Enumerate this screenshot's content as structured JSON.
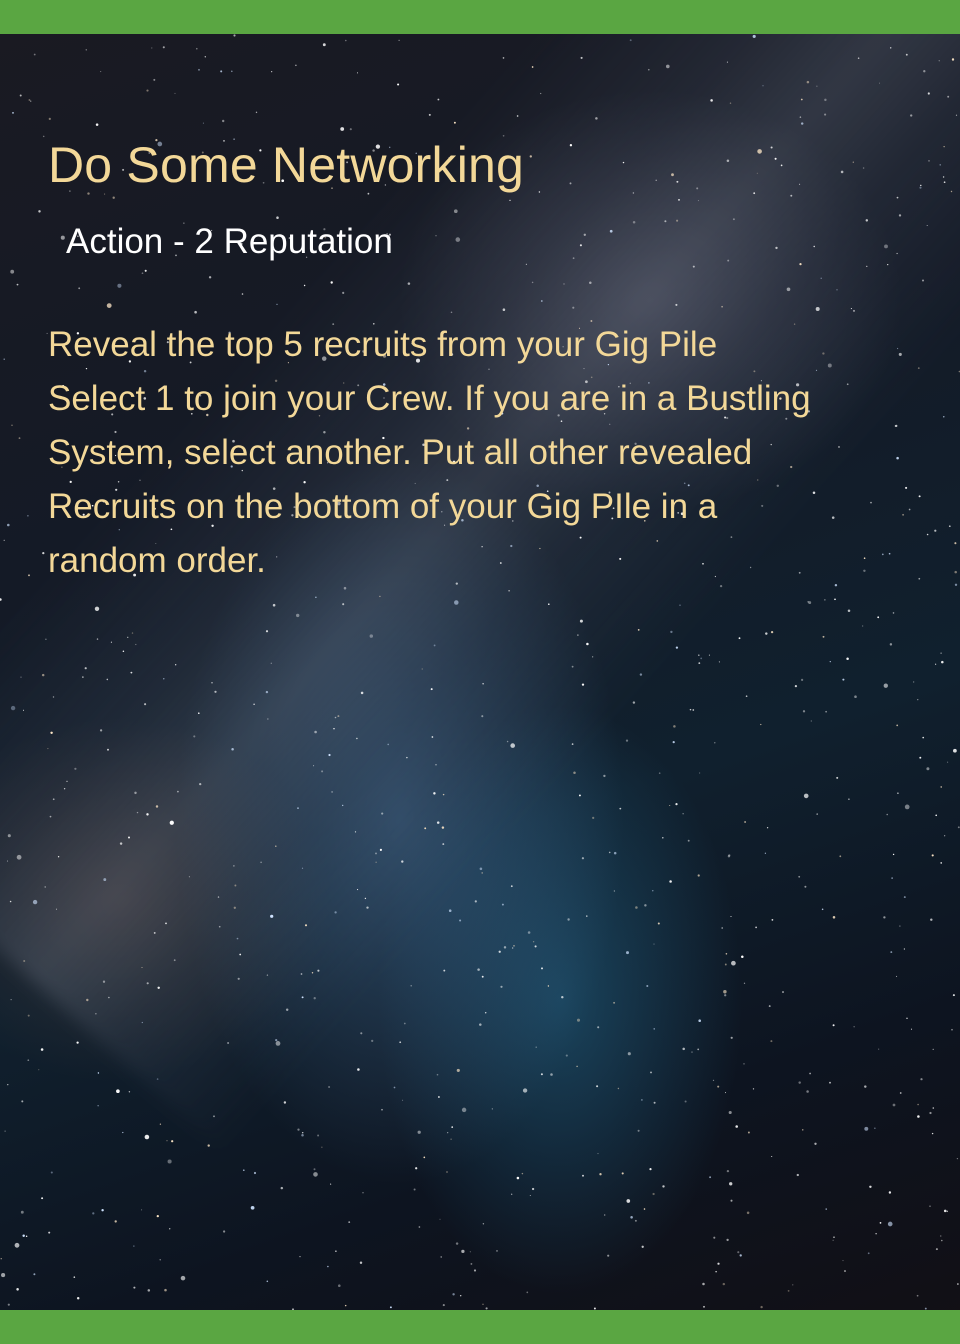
{
  "card": {
    "title": "Do Some Networking",
    "subtitle": "Action - 2 Reputation",
    "body_lines": [
      "Reveal the top 5 recruits from your Gig Pile",
      "Select 1 to join your Crew. If you are in a Bustling",
      "System, select another. Put all other revealed",
      "Recruits on the bottom of your Gig PIle in a",
      "random order."
    ]
  },
  "colors": {
    "frame_bar": "#5aa642",
    "title_text": "#f3d898",
    "subtitle_text": "#ffffff",
    "body_text": "#f3d898"
  }
}
